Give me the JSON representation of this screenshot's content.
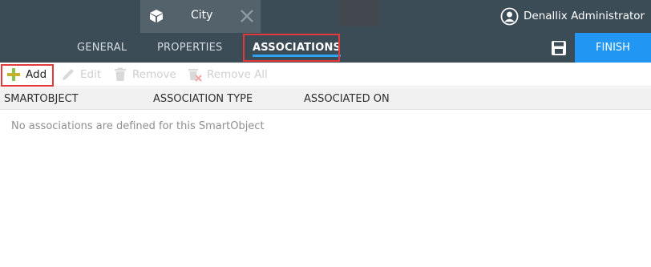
{
  "document_tab": {
    "title": "City",
    "icon": "cube-icon",
    "close_icon": "close-icon"
  },
  "user": {
    "name": "Denallix Administrator",
    "icon": "user-icon"
  },
  "nav": {
    "tabs": [
      {
        "label": "GENERAL",
        "active": false
      },
      {
        "label": "PROPERTIES",
        "active": false
      },
      {
        "label": "ASSOCIATIONS",
        "active": true
      }
    ],
    "save_icon": "save-icon",
    "finish_label": "FINISH"
  },
  "toolbar": {
    "add_label": "Add",
    "edit_label": "Edit",
    "remove_label": "Remove",
    "remove_all_label": "Remove All"
  },
  "table": {
    "columns": [
      "SMARTOBJECT",
      "ASSOCIATION TYPE",
      "ASSOCIATED ON"
    ],
    "empty_message": "No associations are defined for this SmartObject"
  },
  "colors": {
    "header_bg": "#3c4c56",
    "active_tab_bg": "#53626b",
    "accent": "#2196f3",
    "underline": "#2ea3f2",
    "highlight": "#e23a3a",
    "add_icon": "#8bc34a"
  }
}
